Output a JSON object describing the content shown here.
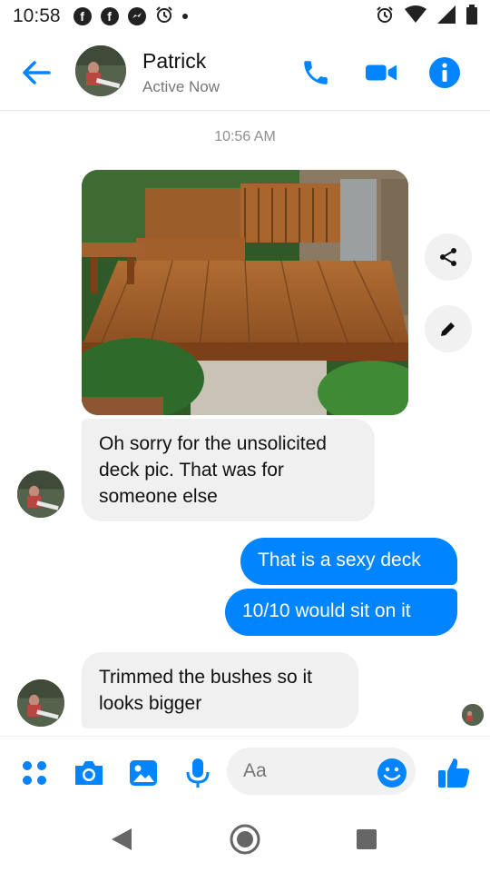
{
  "status_bar": {
    "time": "10:58",
    "left_icons": [
      "facebook-icon",
      "facebook-icon",
      "messenger-icon",
      "alarm-icon",
      "dot-icon"
    ],
    "right_icons": [
      "alarm-icon",
      "wifi-icon",
      "signal-icon",
      "battery-icon"
    ]
  },
  "header": {
    "contact_name": "Patrick",
    "status": "Active Now",
    "actions": [
      "phone-icon",
      "video-icon",
      "info-icon"
    ]
  },
  "conversation": {
    "timestamp": "10:56 AM",
    "image_side_actions": [
      "share-icon",
      "edit-icon"
    ],
    "messages": [
      {
        "from": "contact",
        "type": "image",
        "alt": "photo"
      },
      {
        "from": "contact",
        "type": "text",
        "text": "Oh sorry for the unsolicited deck pic. That was for someone else"
      },
      {
        "from": "me",
        "type": "text",
        "text": "That is a sexy deck"
      },
      {
        "from": "me",
        "type": "text",
        "text": "10/10 would sit on it"
      },
      {
        "from": "contact",
        "type": "text",
        "text": "Trimmed the bushes so it looks bigger"
      }
    ]
  },
  "composer": {
    "placeholder": "Aa",
    "buttons": [
      "apps-icon",
      "camera-icon",
      "gallery-icon",
      "mic-icon",
      "emoji-icon",
      "thumbs-up-icon"
    ]
  },
  "colors": {
    "accent": "#0084ff",
    "incoming_bubble": "#f1f0f0",
    "outgoing_text": "#ffffff"
  },
  "nav_bar": {
    "buttons": [
      "back-triangle-icon",
      "home-circle-icon",
      "recents-square-icon"
    ]
  }
}
